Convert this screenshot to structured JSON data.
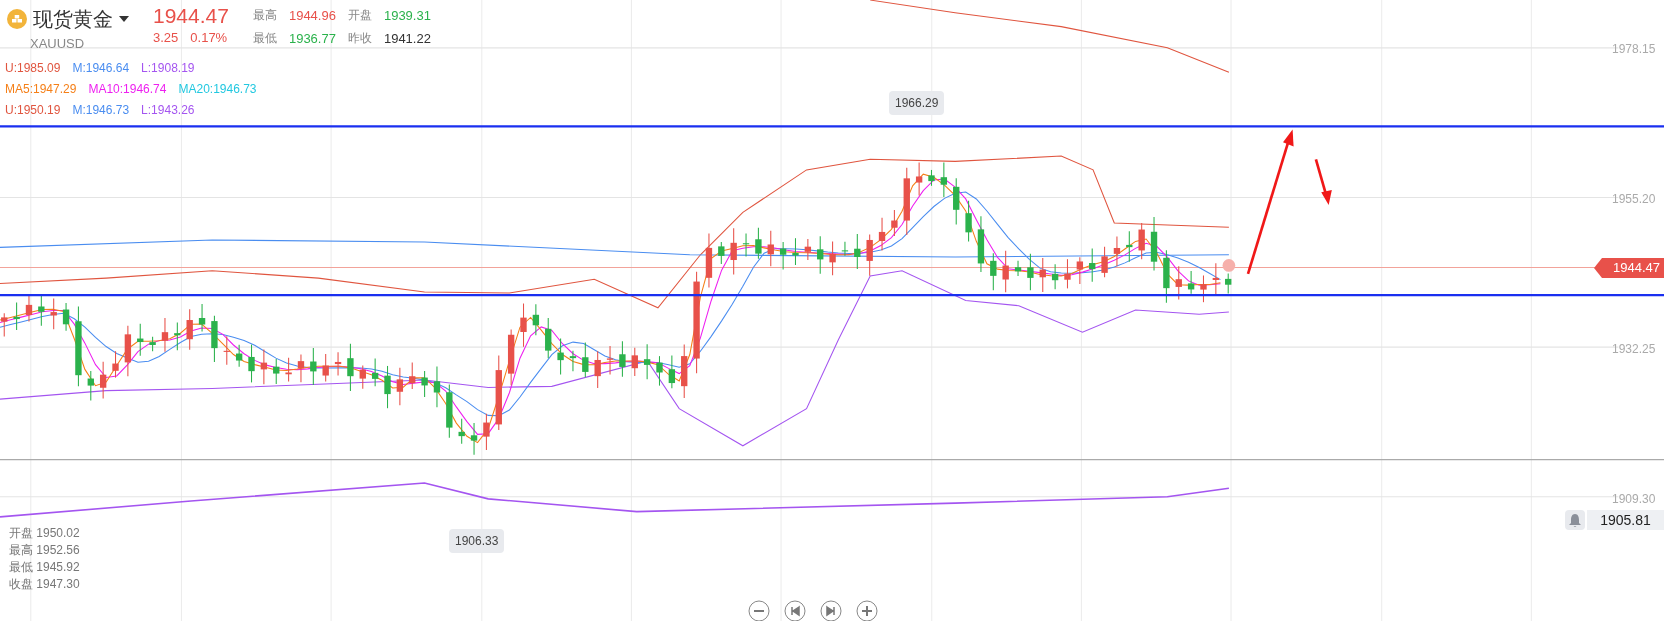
{
  "symbol": {
    "name": "现货黄金",
    "code": "XAUUSD"
  },
  "quote": {
    "price": "1944.47",
    "change": "3.25",
    "change_pct": "0.17%"
  },
  "stats": [
    {
      "label": "最高",
      "value": "1944.96",
      "color": "#e8514a"
    },
    {
      "label": "开盘",
      "value": "1939.31",
      "color": "#2bb24c"
    },
    {
      "label": "最低",
      "value": "1936.77",
      "color": "#2bb24c"
    },
    {
      "label": "昨收",
      "value": "1941.22",
      "color": "#333333"
    }
  ],
  "indicators": [
    [
      {
        "text": "U:1985.09",
        "color": "#e0553f"
      },
      {
        "text": "M:1946.64",
        "color": "#4a8df0"
      },
      {
        "text": "L:1908.19",
        "color": "#a455f0"
      }
    ],
    [
      {
        "text": "MA5:1947.29",
        "color": "#f57f17"
      },
      {
        "text": "MA10:1946.74",
        "color": "#ee1ff0"
      },
      {
        "text": "MA20:1946.73",
        "color": "#22c8e0"
      }
    ],
    [
      {
        "text": "U:1950.19",
        "color": "#e0553f"
      },
      {
        "text": "M:1946.73",
        "color": "#4a8df0"
      },
      {
        "text": "L:1943.26",
        "color": "#a455f0"
      }
    ]
  ],
  "price_axis": [
    "1978.15",
    "1955.20",
    "1932.25",
    "1909.30"
  ],
  "high_marker": "1966.29",
  "low_marker": "1906.33",
  "current_price": "1944.47",
  "alert": "1905.81",
  "ohlc": [
    {
      "label": "开盘",
      "value": "1950.02"
    },
    {
      "label": "最高",
      "value": "1952.56"
    },
    {
      "label": "最低",
      "value": "1945.92"
    },
    {
      "label": "收盘",
      "value": "1947.30"
    }
  ]
}
